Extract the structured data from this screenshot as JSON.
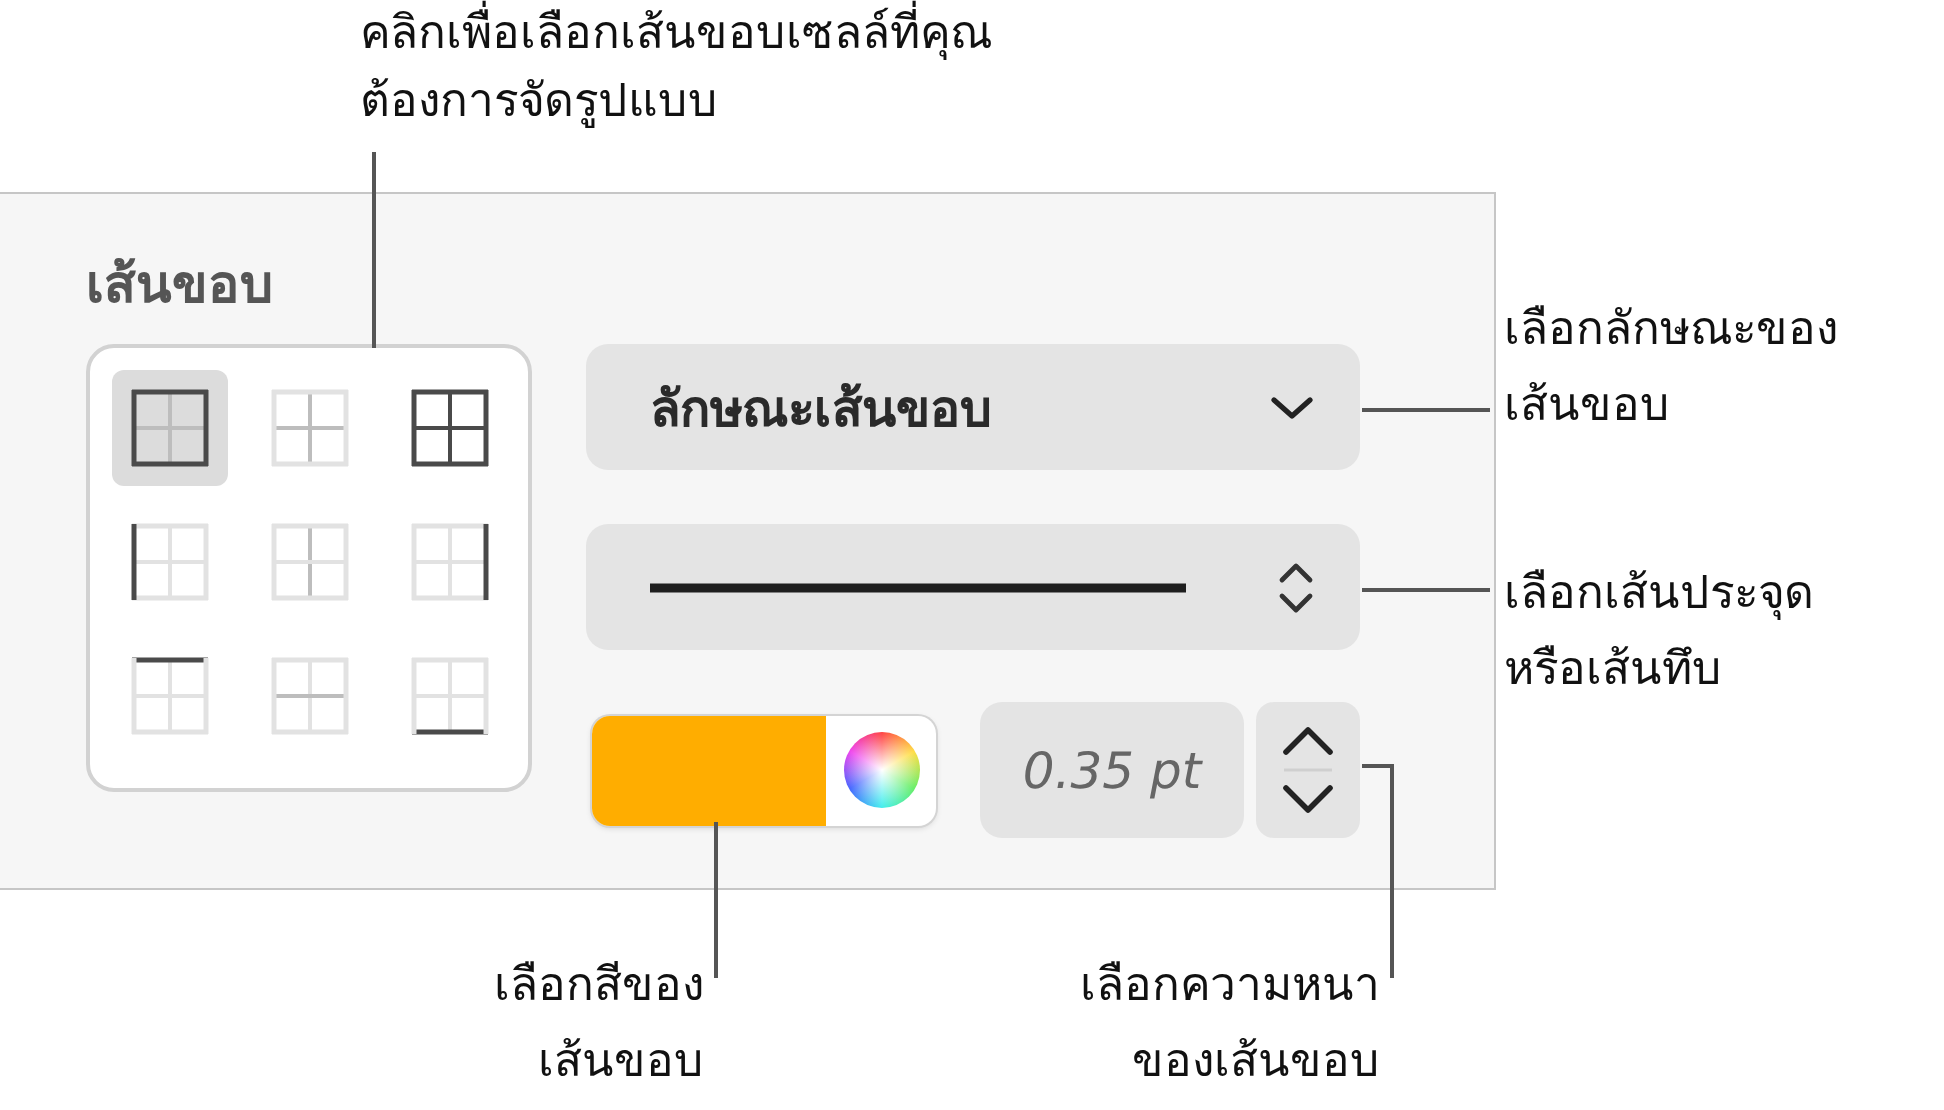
{
  "callouts": [
    {
      "text": "คลิกเพื่อเลือกเส้นขอบเซลล์ที่คุณ\nต้องการจัดรูปแบบ"
    },
    {
      "text": "เลือกลักษณะของ\nเส้นขอบ"
    },
    {
      "text": "เลือกเส้นประจุด\nหรือเส้นทึบ"
    },
    {
      "text": "เลือกสีของ\nเส้นขอบ"
    },
    {
      "text": "เลือกความหนา\nของเส้นขอบ"
    }
  ],
  "panel": {
    "title": "เส้นขอบ",
    "border_presets": [
      {
        "kind": "outer",
        "selected": true
      },
      {
        "kind": "inner",
        "selected": false
      },
      {
        "kind": "all",
        "selected": false
      },
      {
        "kind": "left",
        "selected": false
      },
      {
        "kind": "vertical",
        "selected": false
      },
      {
        "kind": "right",
        "selected": false
      },
      {
        "kind": "top",
        "selected": false
      },
      {
        "kind": "horizontal",
        "selected": false
      },
      {
        "kind": "bottom",
        "selected": false
      }
    ],
    "border_style": {
      "label": "ลักษณะเส้นขอบ"
    },
    "line_style": {
      "kind": "solid"
    },
    "color_well": {
      "color": "#ffad00"
    },
    "thickness": {
      "value": "0.35 pt"
    }
  }
}
